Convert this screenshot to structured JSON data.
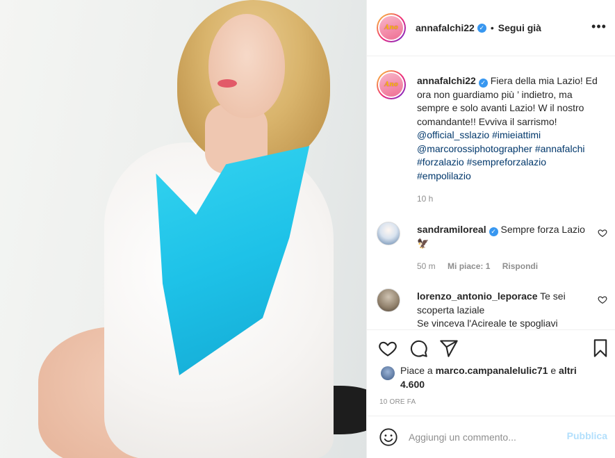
{
  "post": {
    "image_alt": "",
    "author": {
      "username": "annafalchi22",
      "verified": true,
      "follow_status": "Segui già",
      "avatar_text": "Ano"
    },
    "caption": {
      "username": "annafalchi22",
      "text": "Fiera della mia Lazio! Ed ora non guardiamo più ’ indietro, ma sempre e solo avanti Lazio! W il nostro comandante!! Evviva il sarrismo!",
      "mention1": "@official_sslazio",
      "tag1": "#imieiattimi",
      "mention2": "@marcorossiphotographer",
      "tag2": "#annafalchi",
      "tag3": "#forzalazio",
      "tag4": "#sempreforzalazio",
      "tag5": "#empolilazio",
      "time": "10 h"
    },
    "comments": [
      {
        "username": "sandramiloreal",
        "verified": true,
        "text": "Sempre forza Lazio",
        "emoji": "🦅",
        "time": "50 m",
        "likes": "Mi piace: 1",
        "reply": "Rispondi"
      },
      {
        "username": "lorenzo_antonio_leporace",
        "text_line1": "Te sei scoperta laziale",
        "text_line2": "Se vinceva l'Acireale te spogliavi"
      }
    ],
    "likes": {
      "prefix": "Piace a",
      "user": "marco.campanalelulic71",
      "conj": "e",
      "others": "altri 4.600"
    },
    "timestamp": "10 ORE FA",
    "add_comment": {
      "placeholder": "Aggiungi un commento...",
      "publish": "Pubblica"
    }
  },
  "colors": {
    "link": "#00376b",
    "verified": "#3897f0",
    "muted": "#8e8e8e",
    "publish_disabled": "#b2dffc",
    "swimsuit": "#1ec2e8"
  },
  "icons": [
    "more-options-icon",
    "heart-icon",
    "comment-icon",
    "share-icon",
    "bookmark-icon",
    "emoji-icon",
    "small-heart-icon",
    "verified-badge-icon"
  ]
}
